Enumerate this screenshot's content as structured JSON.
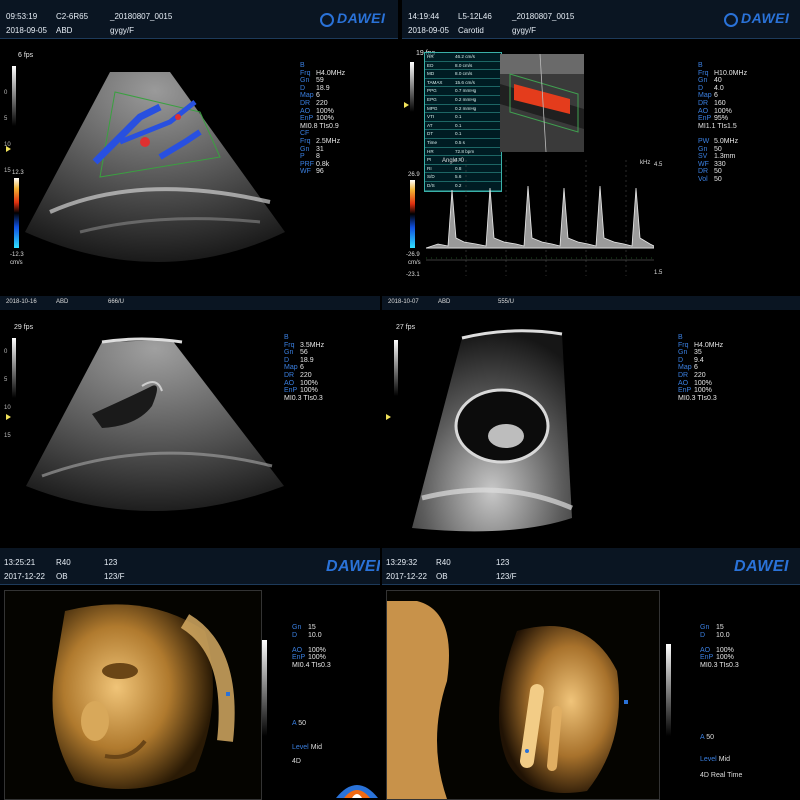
{
  "panels": {
    "p1": {
      "time": "09:53:19",
      "probe": "C2-6R65",
      "file": "_20180807_0015",
      "date": "2018-09-05",
      "exam": "ABD",
      "patient": "gygy/F",
      "logo": "DAWEI",
      "fps": "6 fps",
      "depth_ticks": [
        "0",
        "5",
        "10",
        "15"
      ],
      "cscale": {
        "top": "12.3",
        "bottom": "-12.3",
        "unit": "cm/s"
      },
      "params": [
        {
          "k": "B",
          "v": ""
        },
        {
          "k": "Frq",
          "v": "H4.0MHz"
        },
        {
          "k": "Gn",
          "v": "59"
        },
        {
          "k": "D",
          "v": "18.9"
        },
        {
          "k": "Map",
          "v": "6"
        },
        {
          "k": "DR",
          "v": "220"
        },
        {
          "k": "AO",
          "v": "100%"
        },
        {
          "k": "EnP",
          "v": "100%"
        },
        {
          "k": "",
          "v": "MI0.8 TIs0.9"
        },
        {
          "k": "CF",
          "v": ""
        },
        {
          "k": "Frq",
          "v": "2.5MHz"
        },
        {
          "k": "Gn",
          "v": "31"
        },
        {
          "k": "P",
          "v": "8"
        },
        {
          "k": "PRF",
          "v": "0.8k"
        },
        {
          "k": "WF",
          "v": "96"
        }
      ]
    },
    "p2": {
      "time": "14:19:44",
      "probe": "L5-12L46",
      "file": "_20180807_0015",
      "date": "2018-09-05",
      "exam": "Carotid",
      "patient": "gygy/F",
      "logo": "DAWEI",
      "fps": "19 fps",
      "cscale": {
        "top": "26.9",
        "bottom": "-26.9",
        "unit": "cm/s"
      },
      "angle": "Angle: 0",
      "spectrum_top": "4.5",
      "spectrum_bottom": "1.5",
      "spectrum_unit": "kHz",
      "spectrum_left": "-23.1",
      "params": [
        {
          "k": "B",
          "v": ""
        },
        {
          "k": "Frq",
          "v": "H10.0MHz"
        },
        {
          "k": "Gn",
          "v": "40"
        },
        {
          "k": "D",
          "v": "4.0"
        },
        {
          "k": "Map",
          "v": "6"
        },
        {
          "k": "DR",
          "v": "160"
        },
        {
          "k": "AO",
          "v": "100%"
        },
        {
          "k": "EnP",
          "v": "95%"
        },
        {
          "k": "",
          "v": "MI1.1 TIs1.5"
        },
        {
          "k": "",
          "v": ""
        },
        {
          "k": "PW",
          "v": "5.0MHz"
        },
        {
          "k": "Gn",
          "v": "50"
        },
        {
          "k": "SV",
          "v": "1.3mm"
        },
        {
          "k": "WF",
          "v": "330"
        },
        {
          "k": "DR",
          "v": "50"
        },
        {
          "k": "Vol",
          "v": "50"
        }
      ],
      "measure": [
        {
          "a": "HR",
          "b": "46.2 cm/s"
        },
        {
          "a": "ED",
          "b": "8.0 cm/s"
        },
        {
          "a": "MD",
          "b": "8.0 cm/s"
        },
        {
          "a": "TAMAX",
          "b": "15.6 cm/s"
        },
        {
          "a": "PPG",
          "b": "0.7 mmHg"
        },
        {
          "a": "EPG",
          "b": "0.2 mmHg"
        },
        {
          "a": "MPG",
          "b": "0.2 mmHg"
        },
        {
          "a": "VTI",
          "b": "0.1"
        },
        {
          "a": "AT",
          "b": "0.1"
        },
        {
          "a": "DT",
          "b": "0.1"
        },
        {
          "a": "Time",
          "b": "0.5 s"
        },
        {
          "a": "HR",
          "b": "72.8 bpm"
        },
        {
          "a": "PI",
          "b": "4.5"
        },
        {
          "a": "RI",
          "b": "0.8"
        },
        {
          "a": "S/D",
          "b": "5.6"
        },
        {
          "a": "D/S",
          "b": "0.2"
        }
      ]
    },
    "p3": {
      "date": "2018-10-16",
      "exam": "ABD",
      "patient": "666/U",
      "fps": "29 fps",
      "depth_ticks": [
        "0",
        "5",
        "10",
        "15"
      ],
      "params": [
        {
          "k": "B",
          "v": ""
        },
        {
          "k": "Frq",
          "v": "3.5MHz"
        },
        {
          "k": "Gn",
          "v": "56"
        },
        {
          "k": "D",
          "v": "18.9"
        },
        {
          "k": "Map",
          "v": "6"
        },
        {
          "k": "DR",
          "v": "220"
        },
        {
          "k": "AO",
          "v": "100%"
        },
        {
          "k": "EnP",
          "v": "100%"
        },
        {
          "k": "",
          "v": "MI0.3 TIs0.3"
        }
      ]
    },
    "p4": {
      "date": "2018-10-07",
      "exam": "ABD",
      "patient": "555/U",
      "fps": "27 fps",
      "params": [
        {
          "k": "B",
          "v": ""
        },
        {
          "k": "Frq",
          "v": "H4.0MHz"
        },
        {
          "k": "Gn",
          "v": "35"
        },
        {
          "k": "D",
          "v": "9.4"
        },
        {
          "k": "Map",
          "v": "6"
        },
        {
          "k": "DR",
          "v": "220"
        },
        {
          "k": "AO",
          "v": "100%"
        },
        {
          "k": "EnP",
          "v": "100%"
        },
        {
          "k": "",
          "v": "MI0.3 TIs0.3"
        }
      ]
    },
    "p5": {
      "time": "13:25:21",
      "probe": "R40",
      "id": "123",
      "date": "2017-12-22",
      "exam": "OB",
      "patient": "123/F",
      "logo": "DAWEI",
      "mode": "3D",
      "params": [
        {
          "k": "Gn",
          "v": "15"
        },
        {
          "k": "D",
          "v": "10.0"
        },
        {
          "k": "",
          "v": ""
        },
        {
          "k": "AO",
          "v": "100%"
        },
        {
          "k": "EnP",
          "v": "100%"
        },
        {
          "k": "",
          "v": "MI0.4 TIs0.3"
        }
      ],
      "a_label": "A",
      "a_value": "50",
      "level_label": "Level",
      "level_value": "Mid",
      "status": "4D"
    },
    "p6": {
      "time": "13:29:32",
      "probe": "R40",
      "id": "123",
      "date": "2017-12-22",
      "exam": "OB",
      "patient": "123/F",
      "logo": "DAWEI",
      "mode": "3D",
      "params": [
        {
          "k": "Gn",
          "v": "15"
        },
        {
          "k": "D",
          "v": "10.0"
        },
        {
          "k": "",
          "v": ""
        },
        {
          "k": "AO",
          "v": "100%"
        },
        {
          "k": "EnP",
          "v": "100%"
        },
        {
          "k": "",
          "v": "MI0.3 TIs0.3"
        }
      ],
      "a_label": "A",
      "a_value": "50",
      "level_label": "Level",
      "level_value": "Mid",
      "status": "4D Real Time"
    }
  },
  "colors": {
    "accent": "#2a72d8",
    "param_key": "#3a7fe0",
    "header_bg": "#0a1522"
  }
}
